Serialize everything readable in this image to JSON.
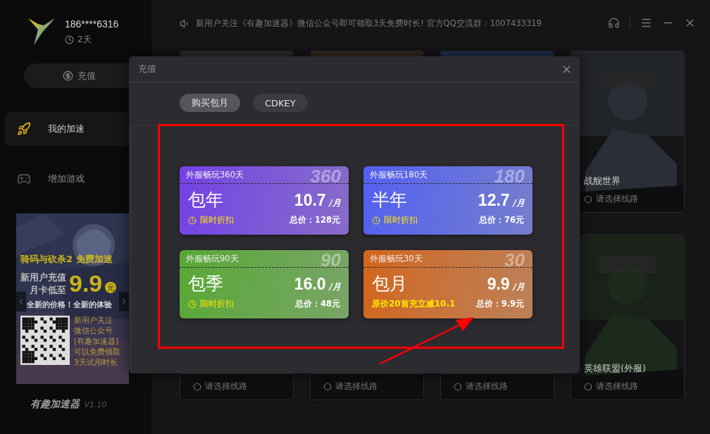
{
  "sidebar": {
    "account": "186****6316",
    "days": "2天",
    "recharge_button": "充值",
    "nav": [
      {
        "label": "我的加速",
        "selected": true,
        "kind": "rocket"
      },
      {
        "label": "增加游戏",
        "selected": false,
        "kind": "gamepad"
      }
    ],
    "ad": {
      "headline": "骑码与砍杀2 免费加速",
      "offer_line_1": "新用户充值",
      "offer_line_2": "月卡低至",
      "price": "9.9",
      "currency": "元",
      "slogan": "全新的价格！全新的体验",
      "qr_text": [
        "新用户关注",
        "微信公众号",
        "[有趣加速器]",
        "可以免费领取",
        "3天试用时长"
      ]
    },
    "app_name": "有趣加速器",
    "version": "V1.10"
  },
  "header": {
    "notice": "新用户关注《有趣加速器》微信公众号即可领取3天免费时长! 官方QQ交流群：1007433319"
  },
  "game_cards": [
    {
      "kind": "picture"
    },
    {
      "kind": "picture"
    },
    {
      "kind": "picture"
    },
    {
      "kind": "picture",
      "title": "战舰世界",
      "route": "请选择线路"
    },
    {
      "kind": "picture",
      "route": "请选择线路"
    },
    {
      "kind": "picture",
      "route": "请选择线路"
    },
    {
      "kind": "picture",
      "route": "请选择线路"
    },
    {
      "kind": "picture",
      "title": "英雄联盟(外服)",
      "route": "请选择线路"
    }
  ],
  "dialog": {
    "title": "充值",
    "tabs": [
      {
        "label": "购买包月",
        "selected": true
      },
      {
        "label": "CDKEY",
        "selected": false
      }
    ],
    "plans": [
      {
        "kind": "discount",
        "color": "#7440e6",
        "tag": "外服畅玩360天",
        "badge": "360",
        "name": "包年",
        "price": "10.7",
        "unit": "/月",
        "note": "限时折扣",
        "total": "总价：128元"
      },
      {
        "kind": "discount",
        "color": "#5360f0",
        "tag": "外服畅玩180天",
        "badge": "180",
        "name": "半年",
        "price": "12.7",
        "unit": "/月",
        "note": "限时折扣",
        "total": "总价：76元"
      },
      {
        "kind": "discount",
        "color": "#58a834",
        "tag": "外服畅玩90天",
        "badge": "90",
        "name": "包季",
        "price": "16.0",
        "unit": "/月",
        "note": "限时折扣",
        "total": "总价：48元"
      },
      {
        "kind": "promo",
        "color": "#d2661a",
        "tag": "外服畅玩30天",
        "badge": "30",
        "name": "包月",
        "price": "9.9",
        "unit": "/月",
        "note": "原价20首充立减10.1",
        "total": "总价：9.9元"
      }
    ]
  }
}
